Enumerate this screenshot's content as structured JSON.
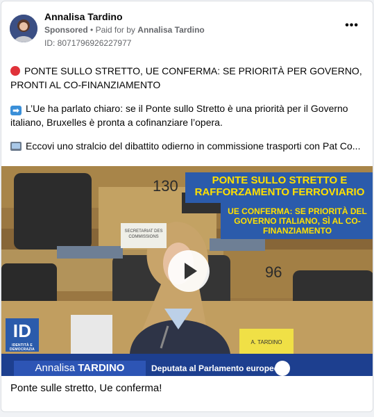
{
  "post": {
    "author": "Annalisa Tardino",
    "sponsored": "Sponsored",
    "paid_for_prefix": "Paid for by",
    "paid_for_name": "Annalisa Tardino",
    "ad_id": "ID: 8071796926227977",
    "more_icon": "more-horizontal-icon",
    "text": {
      "line1": "PONTE SULLO STRETTO, UE CONFERMA: SE PRIORITÀ PER GOVERNO, PRONTI AL CO-FINANZIAMENTO",
      "line2": "L’Ue ha parlato chiaro: se il Ponte sullo Stretto è una priorità per il Governo italiano, Bruxelles è pronta a cofinanziare l’opera.",
      "line3": "Eccovi uno stralcio del dibattito odierno in commissione trasporti con Pat Co..."
    },
    "caption": "Ponte sulle stretto, Ue conferma!"
  },
  "video": {
    "banner_title": "PONTE SULLO STRETTO E RAFFORZAMENTO FERROVIARIO",
    "banner_subtitle": "UE CONFERMA: SE PRIORITÀ DEL GOVERNO ITALIANO, SÌ AL CO-FINANZIAMENTO",
    "speaker_first": "Annalisa",
    "speaker_last": "TARDINO",
    "speaker_role": "Deputata al Parlamento europeo",
    "seat_130": "130",
    "seat_96": "96",
    "nameplate": "A. TARDINO",
    "secretariat": "SECRETARIAT DES COMMISSIONS",
    "logo_letters": "ID",
    "logo_text": "IDENTITÀ E DEMOCRAZIA"
  },
  "colors": {
    "banner_blue": "#2b5bab",
    "banner_yellow": "#ffe000",
    "lower_third": "#1d3f8f"
  }
}
